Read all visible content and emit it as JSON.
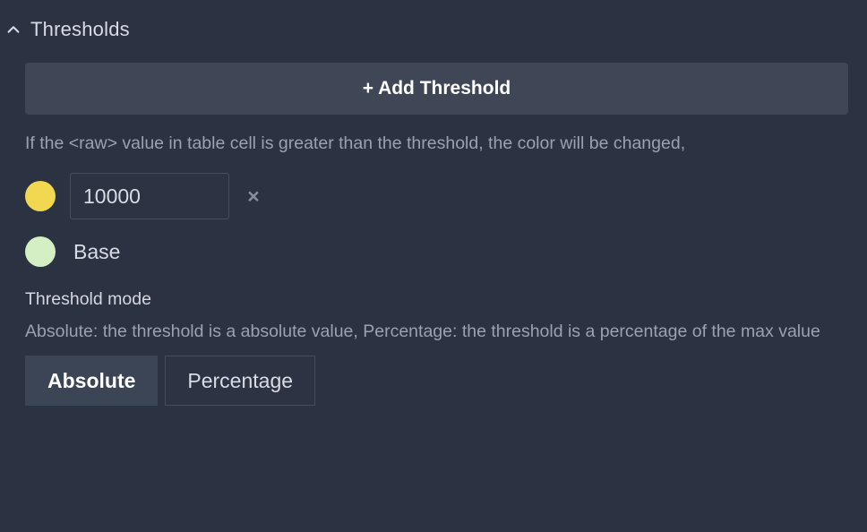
{
  "section": {
    "title": "Thresholds",
    "collapse_icon": "chevron-up-icon",
    "expanded": true
  },
  "add_threshold": {
    "label": "+ Add Threshold"
  },
  "help_text": "If the <raw> value in table cell is greater than the threshold, the color will be changed,",
  "thresholds": [
    {
      "color": "#f2d751",
      "color_name": "yellow",
      "value": "10000",
      "remove_icon": "close-icon",
      "remove_label": "×"
    }
  ],
  "base": {
    "color": "#d4efc3",
    "color_name": "light-green",
    "label": "Base"
  },
  "threshold_mode": {
    "label": "Threshold mode",
    "description": "Absolute: the threshold is a absolute value, Percentage: the threshold is a percentage of the max value",
    "options": [
      {
        "label": "Absolute",
        "selected": true
      },
      {
        "label": "Percentage",
        "selected": false
      }
    ],
    "selected": "Absolute"
  },
  "theme": {
    "background": "#2b3242",
    "panel_button": "#3f4757",
    "text_primary": "#d8dce3",
    "text_secondary": "#9aa2b1",
    "input_background": "#2c3343",
    "border": "#464d5e"
  }
}
